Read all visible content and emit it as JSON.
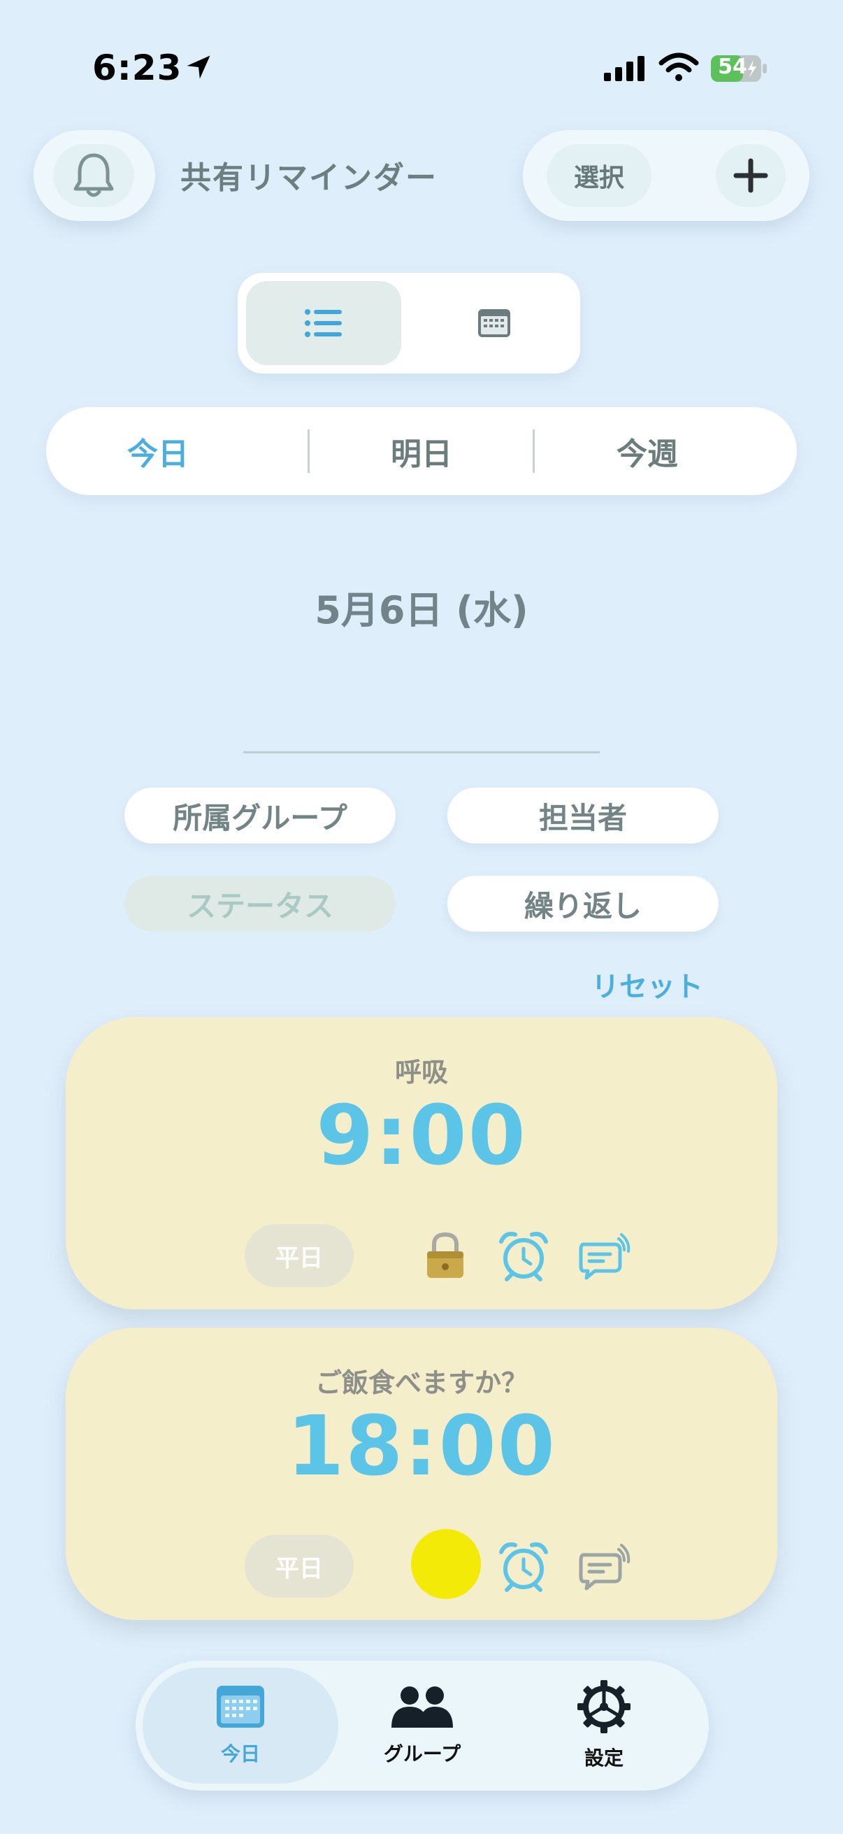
{
  "status_bar": {
    "time": "6:23",
    "battery": "54"
  },
  "header": {
    "title": "共有リマインダー",
    "select_label": "選択"
  },
  "range_tabs": [
    {
      "label": "今日",
      "active": true
    },
    {
      "label": "明日",
      "active": false
    },
    {
      "label": "今週",
      "active": false
    }
  ],
  "date": "5月6日 (水)",
  "filters": [
    {
      "label": "所属グループ",
      "active": false
    },
    {
      "label": "担当者",
      "active": false
    },
    {
      "label": "ステータス",
      "active": true
    },
    {
      "label": "繰り返し",
      "active": false
    }
  ],
  "reset_label": "リセット",
  "reminders": [
    {
      "title": "呼吸",
      "time": "9:00",
      "repeat": "平日",
      "status_icon": "lock-icon"
    },
    {
      "title": "ご飯食べますか？",
      "time": "18:00",
      "repeat": "平日",
      "status_icon": "yellow-circle-icon"
    }
  ],
  "bottom_nav": [
    {
      "label": "今日",
      "icon": "calendar-icon",
      "active": true
    },
    {
      "label": "グループ",
      "icon": "group-icon",
      "active": false
    },
    {
      "label": "設定",
      "icon": "gear-icon",
      "active": false
    }
  ],
  "colors": {
    "accent": "#4aaede",
    "time": "#5cc4e6",
    "card": "#f5eecb",
    "background": "#dfeefb"
  }
}
